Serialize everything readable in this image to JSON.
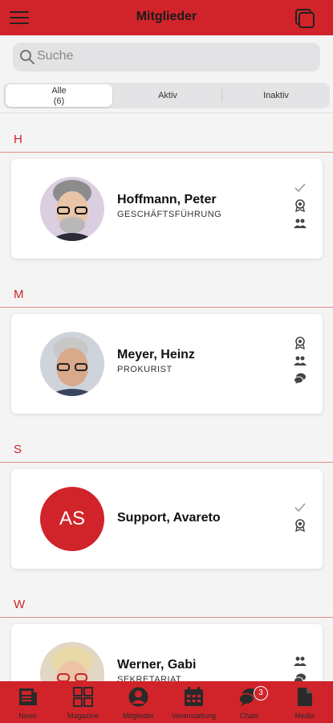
{
  "header": {
    "title": "Mitglieder",
    "menu_icon": "hamburger-menu-icon",
    "action_icon": "cards-stack-icon"
  },
  "search": {
    "placeholder": "Suche"
  },
  "filter": {
    "segments": [
      {
        "label": "Alle",
        "count": "(6)",
        "active": true
      },
      {
        "label": "Aktiv",
        "active": false
      },
      {
        "label": "Inaktiv",
        "active": false
      }
    ]
  },
  "sections": [
    {
      "letter": "H",
      "members": [
        {
          "name": "Hoffmann, Peter",
          "role": "GESCHÄFTSFÜHRUNG",
          "avatar": "photo",
          "icons": [
            "check-icon",
            "award-icon",
            "group-icon"
          ]
        }
      ]
    },
    {
      "letter": "M",
      "members": [
        {
          "name": "Meyer, Heinz",
          "role": "PROKURIST",
          "avatar": "photo",
          "icons": [
            "award-icon",
            "group-icon",
            "chat-bubbles-icon"
          ]
        }
      ]
    },
    {
      "letter": "S",
      "members": [
        {
          "name": "Support, Avareto",
          "role": "",
          "avatar_initials": "AS",
          "icons": [
            "check-icon",
            "award-icon"
          ]
        }
      ]
    },
    {
      "letter": "W",
      "members": [
        {
          "name": "Werner, Gabi",
          "role": "SEKRETARIAT",
          "avatar": "photo",
          "icons": [
            "group-icon",
            "chat-bubbles-icon"
          ]
        }
      ]
    }
  ],
  "tabbar": {
    "tabs": [
      {
        "label": "News",
        "icon": "newspaper-icon"
      },
      {
        "label": "Magazine",
        "icon": "grid-icon"
      },
      {
        "label": "Mitglieder",
        "icon": "person-icon",
        "active": true
      },
      {
        "label": "Veranstaltung",
        "icon": "calendar-icon"
      },
      {
        "label": "Chats",
        "icon": "chat-bubbles-icon",
        "badge": "3"
      },
      {
        "label": "Media",
        "icon": "document-icon"
      }
    ]
  },
  "colors": {
    "brand": "#d0242a",
    "background": "#f4f4f4",
    "card": "#ffffff"
  }
}
